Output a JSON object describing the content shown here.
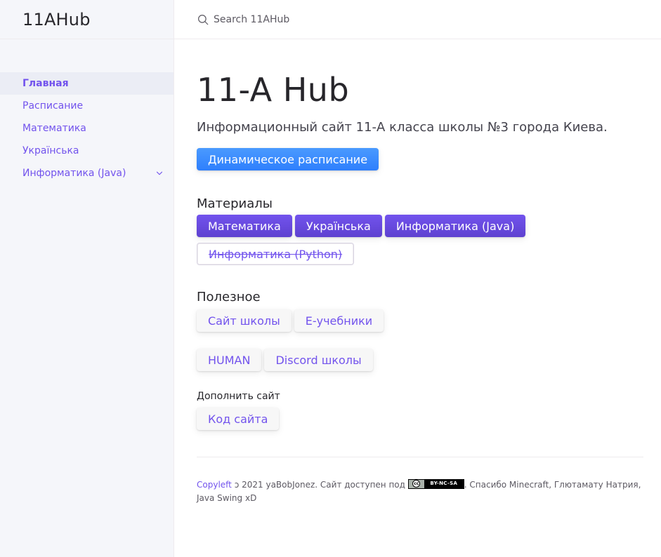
{
  "site": {
    "title": "11AHub"
  },
  "search": {
    "placeholder": "Search 11AHub"
  },
  "nav": {
    "items": [
      {
        "label": "Главная"
      },
      {
        "label": "Расписание"
      },
      {
        "label": "Математика"
      },
      {
        "label": "Українська"
      },
      {
        "label": "Информатика (Java)"
      }
    ]
  },
  "main": {
    "title": "11-A Hub",
    "lead": "Информационный сайт 11-А класса школы №3 города Киева.",
    "schedule_button": "Динамическое расписание",
    "materials": {
      "heading": "Материалы",
      "buttons": [
        "Математика",
        "Українська",
        "Информатика (Java)"
      ],
      "deprecated_button": "Информатика (Python)"
    },
    "useful": {
      "heading": "Полезное",
      "buttons_row1": [
        "Сайт школы",
        "Е-учебники"
      ],
      "buttons_row2": [
        "HUMAN",
        "Discord школы"
      ]
    },
    "contribute": {
      "heading": "Дополнить сайт",
      "button": "Код сайта"
    }
  },
  "footer": {
    "copyleft_link": "Copyleft",
    "copyleft_symbol": "ↄ",
    "text_before_badge": " 2021 yaBobJonez. Сайт доступен под ",
    "badge_cc": "cc",
    "badge_label": "BY-NC-SA",
    "text_after_badge": ". Спасибо Minecraft, Глютамату Натрия, Java Swing xD"
  },
  "colors": {
    "accent": "#7253ed",
    "blue_button": "#2e7ffd",
    "sidebar_bg": "#f5f6fa",
    "text": "#27262b"
  }
}
